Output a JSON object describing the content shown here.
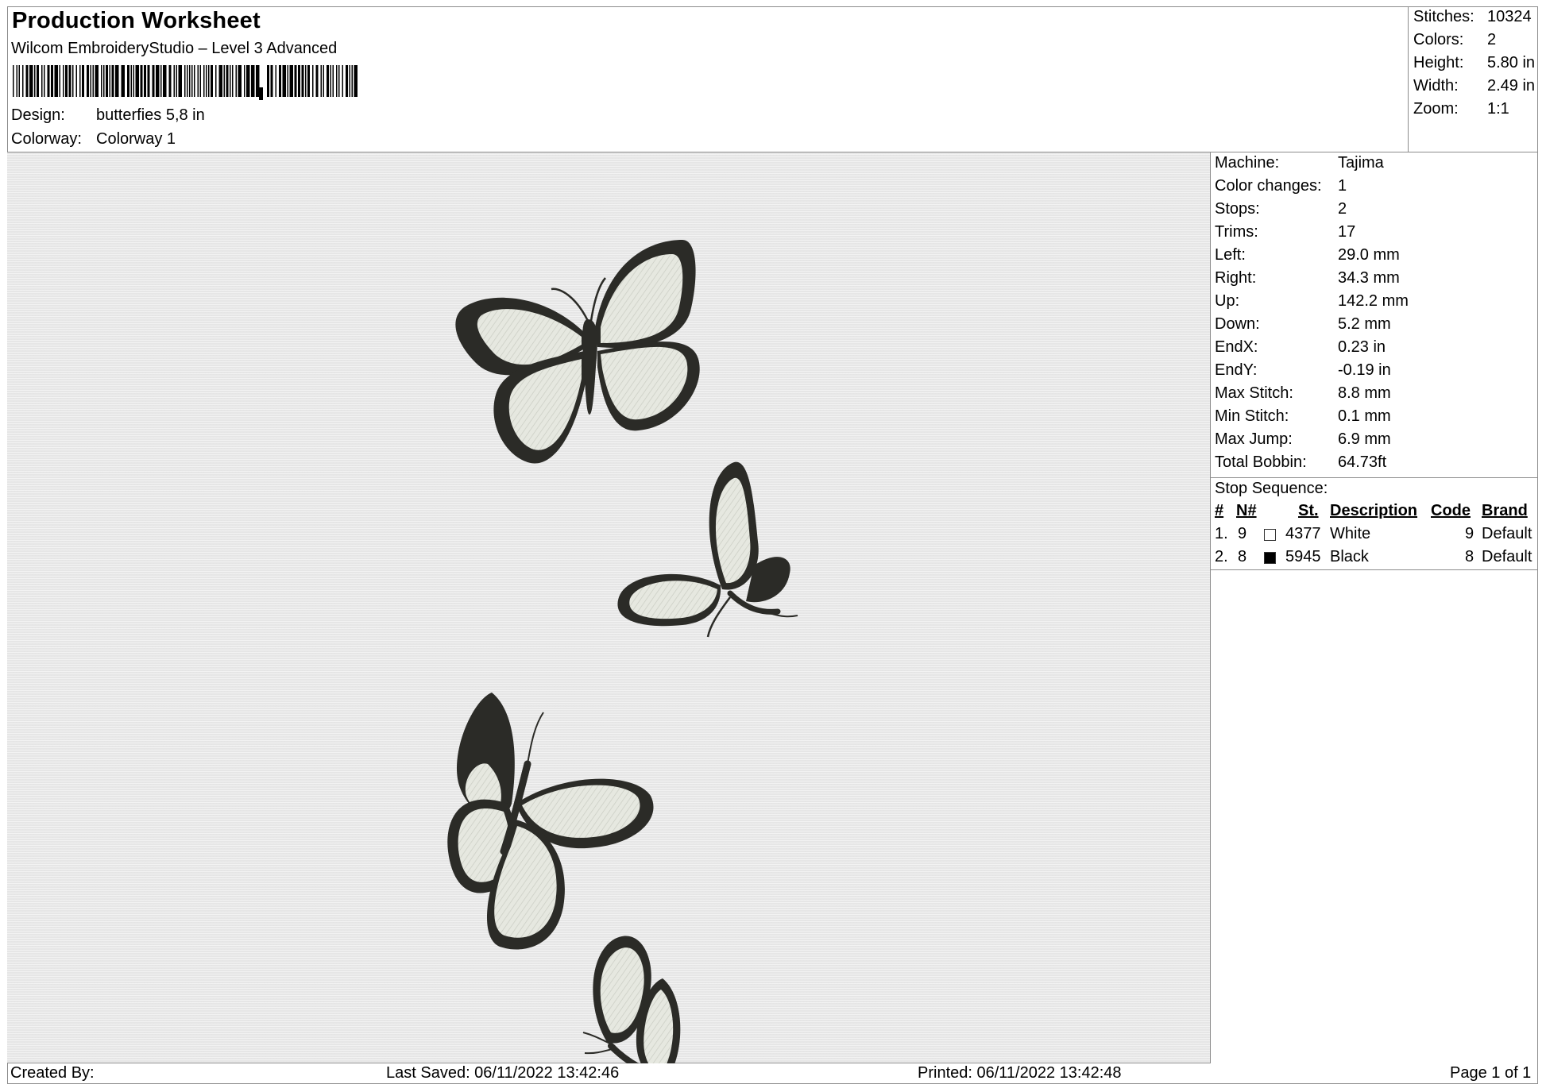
{
  "header": {
    "title": "Production Worksheet",
    "subtitle": "Wilcom EmbroideryStudio – Level 3 Advanced",
    "design_label": "Design:",
    "design_value": "butterfies 5,8 in",
    "colorway_label": "Colorway:",
    "colorway_value": "Colorway 1"
  },
  "stats": [
    {
      "label": "Stitches:",
      "value": "10324"
    },
    {
      "label": "Colors:",
      "value": "2"
    },
    {
      "label": "Height:",
      "value": "5.80 in"
    },
    {
      "label": "Width:",
      "value": "2.49 in"
    },
    {
      "label": "Zoom:",
      "value": "1:1"
    }
  ],
  "machine": [
    {
      "label": "Machine:",
      "value": "Tajima"
    },
    {
      "label": "Color changes:",
      "value": "1"
    },
    {
      "label": "Stops:",
      "value": "2"
    },
    {
      "label": "Trims:",
      "value": "17"
    },
    {
      "label": "Left:",
      "value": "29.0 mm"
    },
    {
      "label": "Right:",
      "value": "34.3 mm"
    },
    {
      "label": "Up:",
      "value": "142.2 mm"
    },
    {
      "label": "Down:",
      "value": "5.2 mm"
    },
    {
      "label": "EndX:",
      "value": "0.23 in"
    },
    {
      "label": "EndY:",
      "value": "-0.19 in"
    },
    {
      "label": "Max Stitch:",
      "value": "8.8 mm"
    },
    {
      "label": "Min Stitch:",
      "value": "0.1 mm"
    },
    {
      "label": "Max Jump:",
      "value": "6.9 mm"
    },
    {
      "label": "Total Bobbin:",
      "value": "64.73ft"
    }
  ],
  "stop_sequence": {
    "title": "Stop Sequence:",
    "headers": {
      "num": "#",
      "needle": "N#",
      "stitches": "St.",
      "description": "Description",
      "code": "Code",
      "brand": "Brand"
    },
    "rows": [
      {
        "num": "1.",
        "needle": "9",
        "color": "#ffffff",
        "stitches": "4377",
        "description": "White",
        "code": "9",
        "brand": "Default"
      },
      {
        "num": "2.",
        "needle": "8",
        "color": "#000000",
        "stitches": "5945",
        "description": "Black",
        "code": "8",
        "brand": "Default"
      }
    ]
  },
  "colors": {
    "thread_dark": "#2b2b27",
    "thread_light": "#e6e8e0",
    "background": "#ebebeb"
  },
  "footer": {
    "created_by": "Created By:",
    "last_saved": "Last Saved: 06/11/2022 13:42:46",
    "printed": "Printed: 06/11/2022 13:42:48",
    "page": "Page 1 of 1"
  }
}
